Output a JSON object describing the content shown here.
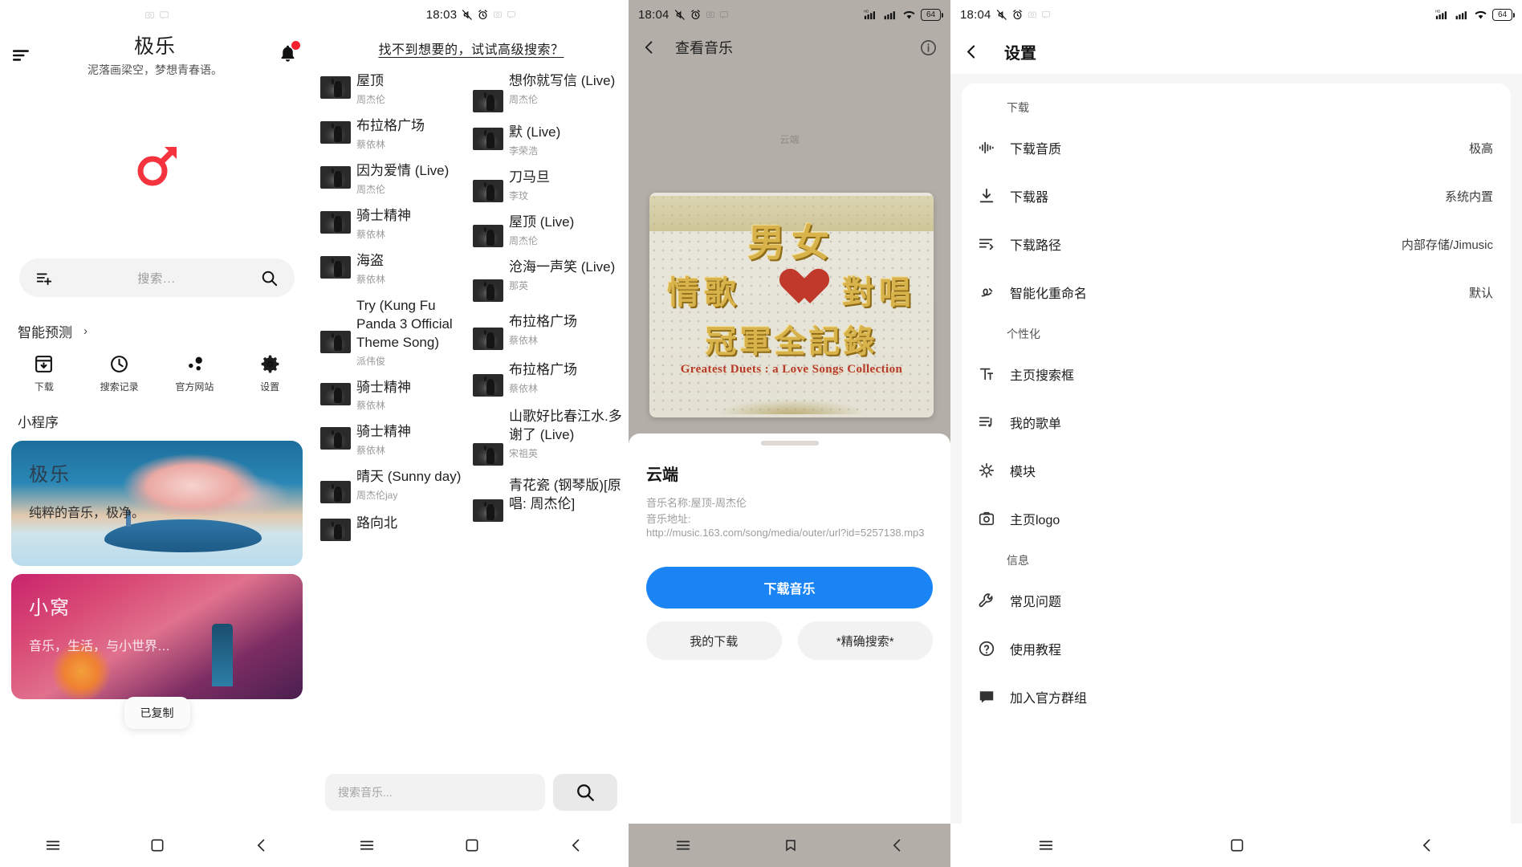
{
  "screen1": {
    "statusbar": {
      "icons": [
        "screenshot-icon",
        "cast-icon"
      ]
    },
    "app_title": "极乐",
    "app_subtitle": "泥落画梁空，梦想青春语。",
    "menu_icon": "sort-menu-icon",
    "bell_icon": "notification-bell-icon",
    "logo_icon": "mars-symbol-logo",
    "search": {
      "placeholder": "搜索...",
      "left_icon": "playlist-add-icon",
      "right_icon": "search-icon"
    },
    "predict_section": {
      "label": "智能预测",
      "chevron": "›"
    },
    "quick_actions": [
      {
        "icon": "download-box-icon",
        "label": "下载"
      },
      {
        "icon": "clock-history-icon",
        "label": "搜索记录"
      },
      {
        "icon": "share-nodes-icon",
        "label": "官方网站"
      },
      {
        "icon": "gear-icon",
        "label": "设置"
      }
    ],
    "miniprogram_label": "小程序",
    "cards": [
      {
        "title": "极乐",
        "subtitle": "纯粹的音乐，极净。"
      },
      {
        "title": "小窝",
        "subtitle": "音乐，生活，与小世界…"
      }
    ],
    "toast": "已复制",
    "navbar": [
      "recents-icon",
      "home-icon",
      "back-icon"
    ]
  },
  "screen2": {
    "statusbar": {
      "time": "18:03",
      "icons": [
        "mute-icon",
        "alarm-icon",
        "screenshot-icon",
        "cast-icon"
      ]
    },
    "advanced_search": "找不到想要的，试试高级搜索？",
    "results_left": [
      {
        "title": "屋顶",
        "artist": "周杰伦"
      },
      {
        "title": "布拉格广场",
        "artist": "蔡依林"
      },
      {
        "title": "因为爱情 (Live)",
        "artist": "周杰伦"
      },
      {
        "title": "骑士精神",
        "artist": "蔡依林"
      },
      {
        "title": "海盗",
        "artist": "蔡依林"
      },
      {
        "title": "Try (Kung Fu Panda 3 Official Theme Song)",
        "artist": "派伟俊"
      },
      {
        "title": "骑士精神",
        "artist": "蔡依林"
      },
      {
        "title": "骑士精神",
        "artist": "蔡依林"
      },
      {
        "title": "晴天 (Sunny day)",
        "artist": "周杰伦jay"
      },
      {
        "title": "路向北",
        "artist": ""
      }
    ],
    "results_right": [
      {
        "title": "想你就写信 (Live)",
        "artist": "周杰伦"
      },
      {
        "title": "默 (Live)",
        "artist": "李荣浩"
      },
      {
        "title": "刀马旦",
        "artist": "李玟"
      },
      {
        "title": "屋顶 (Live)",
        "artist": "周杰伦"
      },
      {
        "title": "沧海一声笑 (Live)",
        "artist": "那英"
      },
      {
        "title": "布拉格广场",
        "artist": "蔡依林"
      },
      {
        "title": "布拉格广场",
        "artist": "蔡依林"
      },
      {
        "title": "山歌好比春江水.多谢了 (Live)",
        "artist": "宋祖英"
      },
      {
        "title": "青花瓷 (钢琴版)[原唱: 周杰伦]",
        "artist": ""
      }
    ],
    "search_input": {
      "placeholder": "搜索音乐...",
      "value": ""
    },
    "search_button_icon": "search-icon",
    "navbar": [
      "recents-icon",
      "home-icon",
      "back-icon"
    ]
  },
  "screen3": {
    "statusbar": {
      "time": "18:04",
      "left_icons": [
        "mute-icon",
        "alarm-icon",
        "screenshot-icon",
        "cast-icon"
      ],
      "right_icons": [
        "hd-signal-icon",
        "signal-icon",
        "wifi-icon"
      ],
      "battery": "64"
    },
    "topbar": {
      "back_icon": "back-chevron-icon",
      "title": "查看音乐",
      "info_icon": "info-circle-icon"
    },
    "bg_label": "云端",
    "cover": {
      "line1": "男女",
      "line2": "情歌",
      "line3": "冠軍全記錄",
      "line4": "Greatest Duets : a Love Songs Collection",
      "heart": "heart-shape",
      "right_text": "對唱"
    },
    "detail_title": "云端",
    "meta_name": "音乐名称:屋顶-周杰伦",
    "meta_url_label": "音乐地址:",
    "meta_url": "http://music.163.com/song/media/outer/url?id=5257138.mp3",
    "download_button": "下载音乐",
    "secondary_buttons": [
      "我的下载",
      "*精确搜索*"
    ],
    "navbar": [
      "recents-icon",
      "home-icon",
      "back-icon"
    ]
  },
  "screen4": {
    "statusbar": {
      "time": "18:04",
      "left_icons": [
        "mute-icon",
        "alarm-icon",
        "screenshot-icon",
        "cast-icon"
      ],
      "right_icons": [
        "hd-signal-icon",
        "signal-icon",
        "wifi-icon"
      ],
      "battery": "64"
    },
    "topbar": {
      "back_icon": "back-chevron-icon",
      "title": "设置"
    },
    "groups": [
      {
        "label": "下载",
        "rows": [
          {
            "icon": "audio-wave-icon",
            "label": "下载音质",
            "value": "极高"
          },
          {
            "icon": "download-icon",
            "label": "下载器",
            "value": "系统内置"
          },
          {
            "icon": "path-list-icon",
            "label": "下载路径",
            "value": "内部存储/Jimusic"
          },
          {
            "icon": "rename-icon",
            "label": "智能化重命名",
            "value": "默认"
          }
        ]
      },
      {
        "label": "个性化",
        "rows": [
          {
            "icon": "text-format-icon",
            "label": "主页搜索框",
            "value": ""
          },
          {
            "icon": "playlist-icon",
            "label": "我的歌单",
            "value": ""
          },
          {
            "icon": "module-icon",
            "label": "模块",
            "value": ""
          },
          {
            "icon": "camera-logo-icon",
            "label": "主页logo",
            "value": ""
          }
        ]
      },
      {
        "label": "信息",
        "rows": [
          {
            "icon": "wrench-icon",
            "label": "常见问题",
            "value": ""
          },
          {
            "icon": "question-circle-icon",
            "label": "使用教程",
            "value": ""
          },
          {
            "icon": "chat-group-icon",
            "label": "加入官方群组",
            "value": ""
          }
        ]
      }
    ],
    "navbar": [
      "recents-icon",
      "home-icon",
      "back-icon"
    ]
  }
}
